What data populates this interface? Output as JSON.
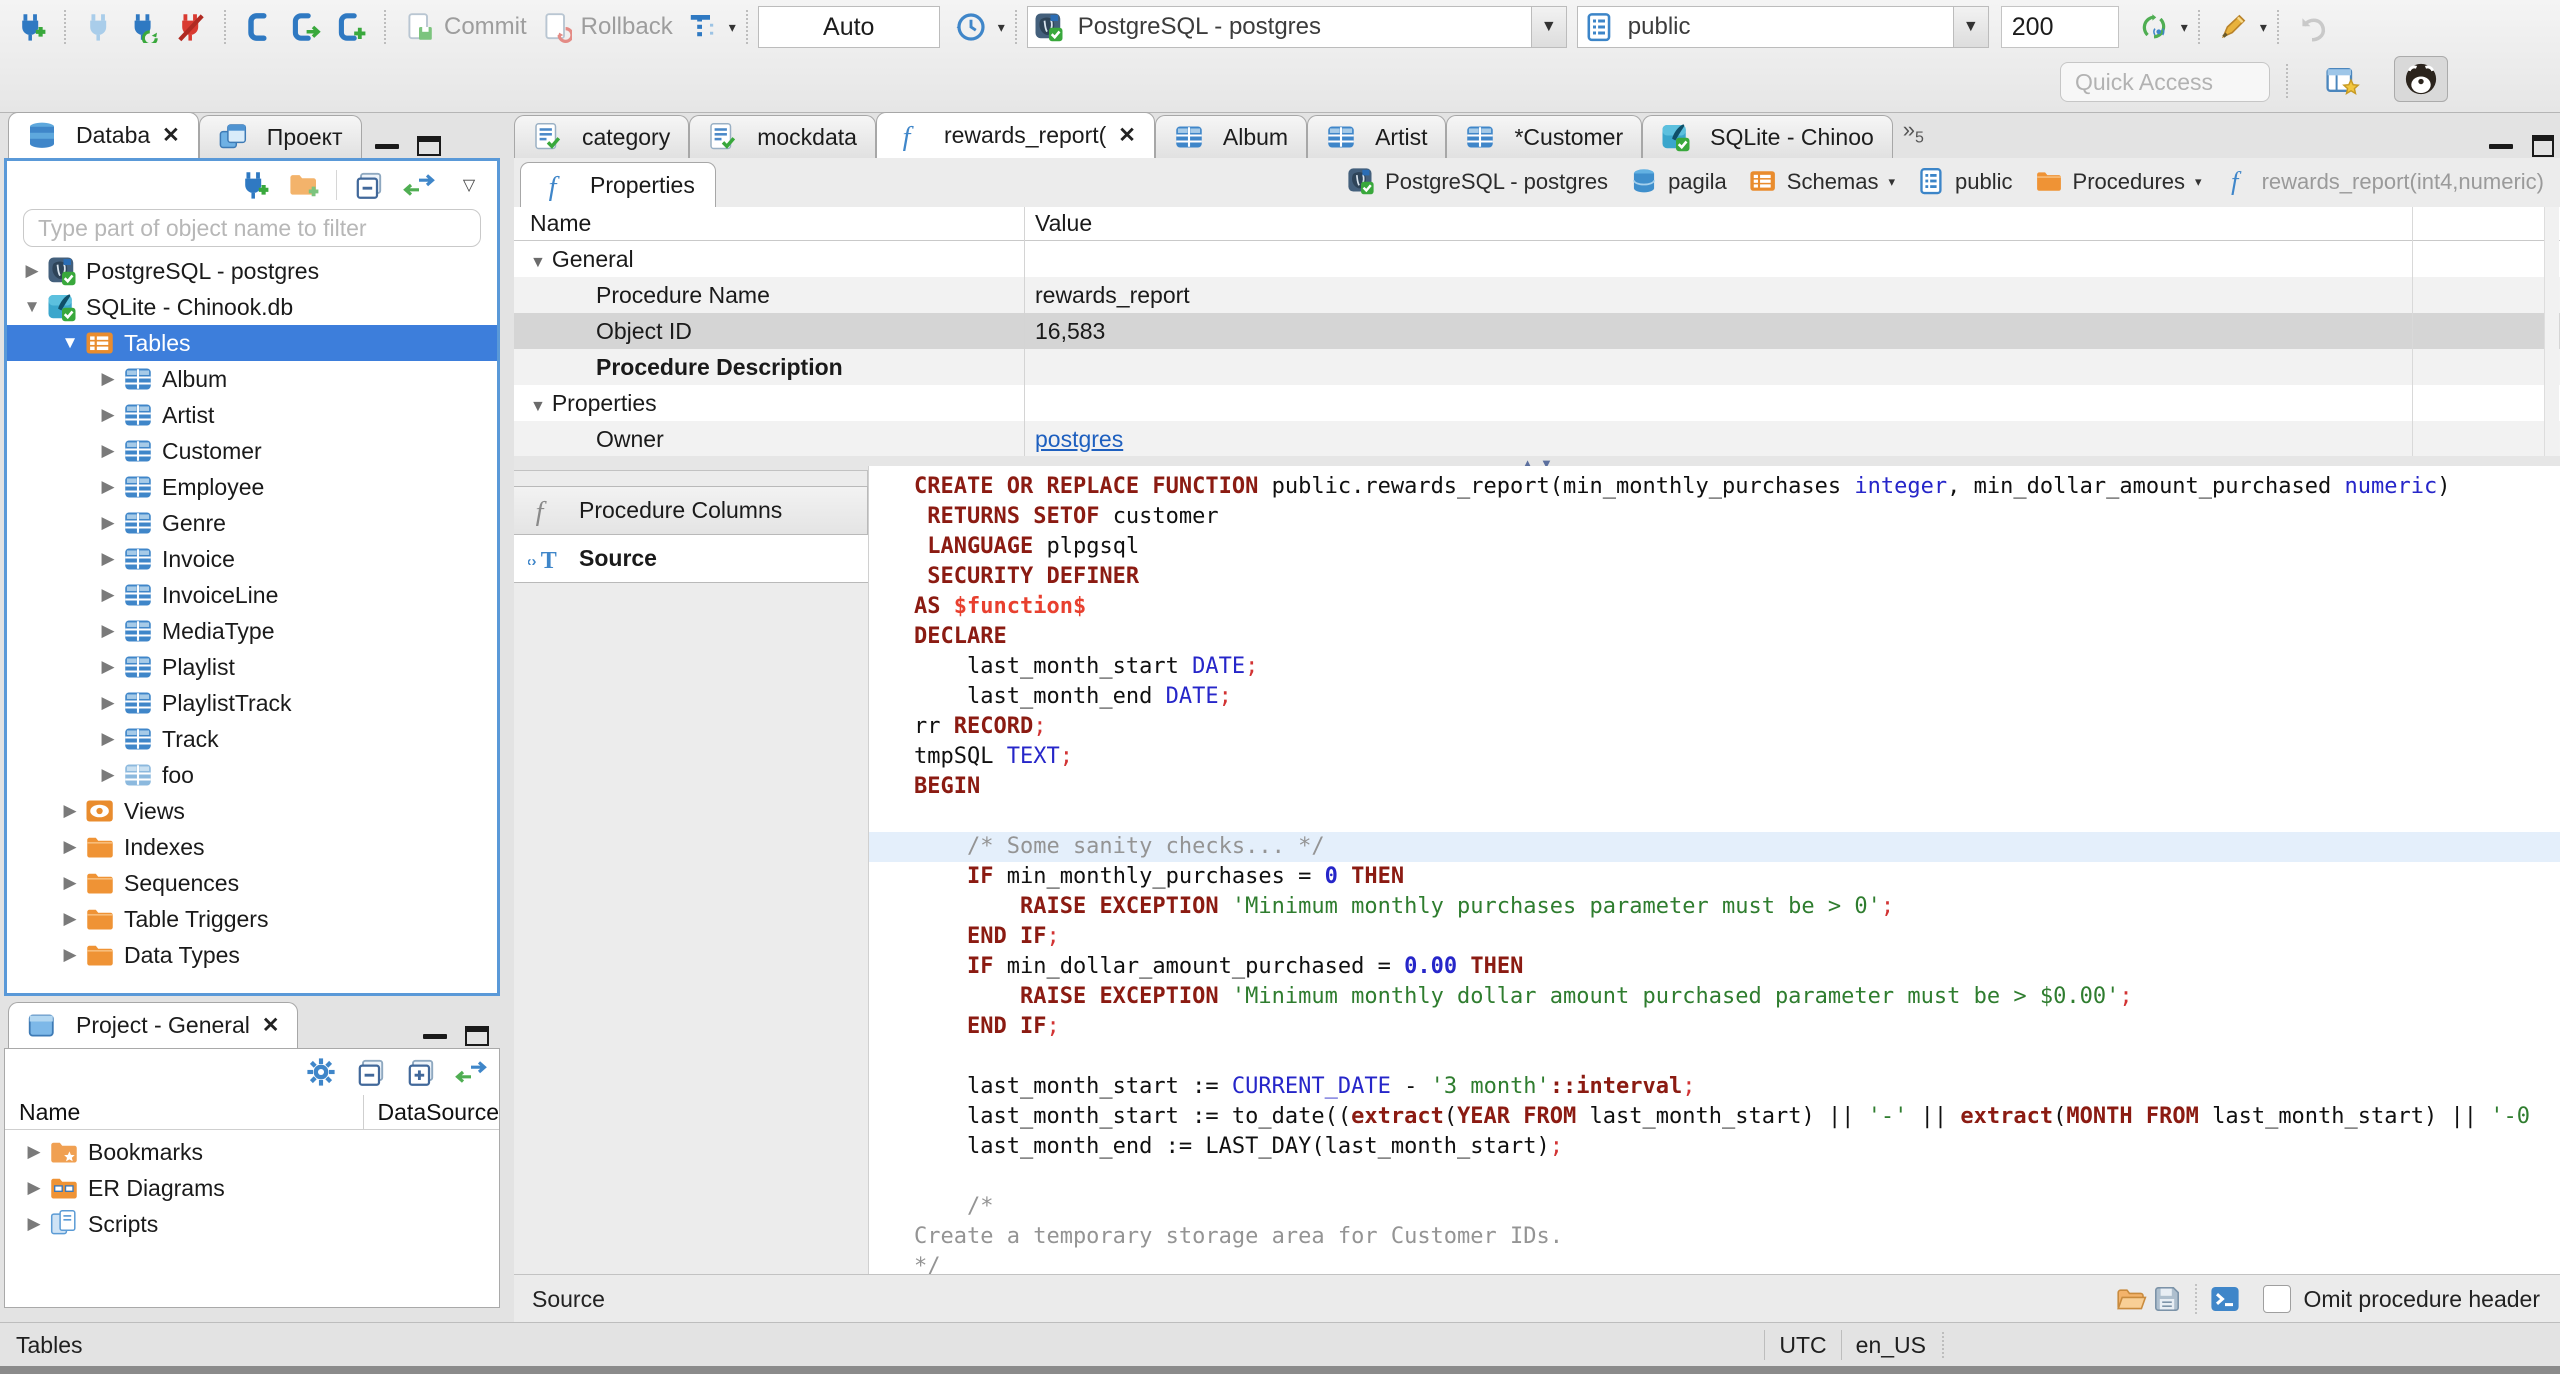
{
  "toolbar": {
    "commit": "Commit",
    "rollback": "Rollback",
    "txn_mode": "Auto",
    "connection": "PostgreSQL - postgres",
    "schema": "public",
    "fetch_size": "200",
    "quick_access": "Quick Access"
  },
  "navigator": {
    "tabs": [
      {
        "label": "Databa",
        "icon": "db-navigator",
        "active": true,
        "closable": true
      },
      {
        "label": "Проект",
        "icon": "windows"
      }
    ],
    "filter_placeholder": "Type part of object name to filter",
    "tree": [
      {
        "label": "PostgreSQL - postgres",
        "icon": "postgres",
        "depth": 0,
        "twist": "right"
      },
      {
        "label": "SQLite - Chinook.db",
        "icon": "sqlite",
        "depth": 0,
        "twist": "down"
      },
      {
        "label": "Tables",
        "icon": "tables-folder",
        "depth": 1,
        "twist": "down",
        "selected": true
      },
      {
        "label": "Album",
        "icon": "table",
        "depth": 2,
        "twist": "right"
      },
      {
        "label": "Artist",
        "icon": "table",
        "depth": 2,
        "twist": "right"
      },
      {
        "label": "Customer",
        "icon": "table",
        "depth": 2,
        "twist": "right"
      },
      {
        "label": "Employee",
        "icon": "table",
        "depth": 2,
        "twist": "right"
      },
      {
        "label": "Genre",
        "icon": "table",
        "depth": 2,
        "twist": "right"
      },
      {
        "label": "Invoice",
        "icon": "table",
        "depth": 2,
        "twist": "right"
      },
      {
        "label": "InvoiceLine",
        "icon": "table",
        "depth": 2,
        "twist": "right"
      },
      {
        "label": "MediaType",
        "icon": "table",
        "depth": 2,
        "twist": "right"
      },
      {
        "label": "Playlist",
        "icon": "table",
        "depth": 2,
        "twist": "right"
      },
      {
        "label": "PlaylistTrack",
        "icon": "table",
        "depth": 2,
        "twist": "right"
      },
      {
        "label": "Track",
        "icon": "table",
        "depth": 2,
        "twist": "right"
      },
      {
        "label": "foo",
        "icon": "table-light",
        "depth": 2,
        "twist": "right"
      },
      {
        "label": "Views",
        "icon": "views",
        "depth": 1,
        "twist": "right"
      },
      {
        "label": "Indexes",
        "icon": "folder",
        "depth": 1,
        "twist": "right"
      },
      {
        "label": "Sequences",
        "icon": "folder",
        "depth": 1,
        "twist": "right"
      },
      {
        "label": "Table Triggers",
        "icon": "folder",
        "depth": 1,
        "twist": "right"
      },
      {
        "label": "Data Types",
        "icon": "folder",
        "depth": 1,
        "twist": "right"
      }
    ]
  },
  "project": {
    "title": "Project - General",
    "columns": [
      "Name",
      "DataSource"
    ],
    "items": [
      {
        "label": "Bookmarks",
        "icon": "bookmarks"
      },
      {
        "label": "ER Diagrams",
        "icon": "erd"
      },
      {
        "label": "Scripts",
        "icon": "scripts"
      }
    ]
  },
  "editor": {
    "tabs": [
      {
        "label": "category",
        "icon": "sql-script"
      },
      {
        "label": "mockdata",
        "icon": "sql-script"
      },
      {
        "label": "rewards_report(",
        "icon": "function",
        "active": true,
        "closable": true
      },
      {
        "label": "Album",
        "icon": "table"
      },
      {
        "label": "Artist",
        "icon": "table"
      },
      {
        "label": "*Customer",
        "icon": "table"
      },
      {
        "label": "SQLite - Chinoo",
        "icon": "sqlite"
      }
    ],
    "overflow_count": "5",
    "properties_tab": "Properties",
    "breadcrumb": [
      {
        "label": "PostgreSQL - postgres",
        "icon": "postgres"
      },
      {
        "label": "pagila",
        "icon": "database"
      },
      {
        "label": "Schemas",
        "icon": "tables-folder",
        "dropdown": true
      },
      {
        "label": "public",
        "icon": "schema"
      },
      {
        "label": "Procedures",
        "icon": "folder",
        "dropdown": true
      },
      {
        "label": "rewards_report(int4,numeric)",
        "icon": "function",
        "dim": true
      }
    ],
    "grid_columns": [
      "Name",
      "Value"
    ],
    "grid_rows": [
      {
        "name": "General",
        "group": true
      },
      {
        "name": "Procedure Name",
        "value": "rewards_report",
        "zebra": true
      },
      {
        "name": "Object ID",
        "value": "16,583",
        "selected": true
      },
      {
        "name": "Procedure Description",
        "value": "",
        "bold": true,
        "zebra": true
      },
      {
        "name": "Properties",
        "group": true
      },
      {
        "name": "Owner",
        "value": "postgres",
        "link": true,
        "zebra": true
      }
    ],
    "side_tabs": [
      {
        "label": "Procedure Columns",
        "icon": "function-gray"
      },
      {
        "label": "Source",
        "icon": "source",
        "active": true
      }
    ],
    "status_left": "Source",
    "omit_checkbox_label": "Omit procedure header"
  },
  "source_code": {
    "lines": [
      {
        "t": [
          [
            "k",
            "CREATE OR REPLACE FUNCTION "
          ],
          [
            "d",
            "public.rewards_report(min_monthly_purchases "
          ],
          [
            "t",
            "integer"
          ],
          [
            "d",
            ", min_dollar_amount_purchased "
          ],
          [
            "t",
            "numeric"
          ],
          [
            "d",
            ")"
          ]
        ]
      },
      {
        "t": [
          [
            "d",
            " "
          ],
          [
            "k",
            "RETURNS SETOF "
          ],
          [
            "d",
            "customer"
          ]
        ]
      },
      {
        "t": [
          [
            "d",
            " "
          ],
          [
            "k",
            "LANGUAGE "
          ],
          [
            "d",
            "plpgsql"
          ]
        ]
      },
      {
        "t": [
          [
            "d",
            " "
          ],
          [
            "k",
            "SECURITY DEFINER"
          ]
        ]
      },
      {
        "t": [
          [
            "k",
            "AS "
          ],
          [
            "f",
            "$function$"
          ]
        ]
      },
      {
        "t": [
          [
            "k",
            "DECLARE"
          ]
        ]
      },
      {
        "t": [
          [
            "d",
            "    last_month_start "
          ],
          [
            "t",
            "DATE"
          ],
          [
            "p",
            ";"
          ]
        ]
      },
      {
        "t": [
          [
            "d",
            "    last_month_end "
          ],
          [
            "t",
            "DATE"
          ],
          [
            "p",
            ";"
          ]
        ]
      },
      {
        "t": [
          [
            "d",
            "rr "
          ],
          [
            "k",
            "RECORD"
          ],
          [
            "p",
            ";"
          ]
        ]
      },
      {
        "t": [
          [
            "d",
            "tmpSQL "
          ],
          [
            "t",
            "TEXT"
          ],
          [
            "p",
            ";"
          ]
        ]
      },
      {
        "t": [
          [
            "k",
            "BEGIN"
          ]
        ]
      },
      {
        "t": []
      },
      {
        "hl": true,
        "t": [
          [
            "c",
            "    /* Some sanity checks... */"
          ]
        ]
      },
      {
        "t": [
          [
            "d",
            "    "
          ],
          [
            "k",
            "IF"
          ],
          [
            "d",
            " min_monthly_purchases = "
          ],
          [
            "n",
            "0"
          ],
          [
            "d",
            " "
          ],
          [
            "k",
            "THEN"
          ]
        ]
      },
      {
        "t": [
          [
            "d",
            "        "
          ],
          [
            "k",
            "RAISE EXCEPTION "
          ],
          [
            "s",
            "'Minimum monthly purchases parameter must be > 0'"
          ],
          [
            "p",
            ";"
          ]
        ]
      },
      {
        "t": [
          [
            "d",
            "    "
          ],
          [
            "k",
            "END IF"
          ],
          [
            "p",
            ";"
          ]
        ]
      },
      {
        "t": [
          [
            "d",
            "    "
          ],
          [
            "k",
            "IF"
          ],
          [
            "d",
            " min_dollar_amount_purchased = "
          ],
          [
            "n",
            "0.00"
          ],
          [
            "d",
            " "
          ],
          [
            "k",
            "THEN"
          ]
        ]
      },
      {
        "t": [
          [
            "d",
            "        "
          ],
          [
            "k",
            "RAISE EXCEPTION "
          ],
          [
            "s",
            "'Minimum monthly dollar amount purchased parameter must be > $0.00'"
          ],
          [
            "p",
            ";"
          ]
        ]
      },
      {
        "t": [
          [
            "d",
            "    "
          ],
          [
            "k",
            "END IF"
          ],
          [
            "p",
            ";"
          ]
        ]
      },
      {
        "t": []
      },
      {
        "t": [
          [
            "d",
            "    last_month_start := "
          ],
          [
            "t",
            "CURRENT_DATE"
          ],
          [
            "d",
            " - "
          ],
          [
            "s",
            "'3 month'"
          ],
          [
            "k",
            "::interval"
          ],
          [
            "p",
            ";"
          ]
        ]
      },
      {
        "t": [
          [
            "d",
            "    last_month_start := to_date(("
          ],
          [
            "k",
            "extract"
          ],
          [
            "d",
            "("
          ],
          [
            "k",
            "YEAR FROM"
          ],
          [
            "d",
            " last_month_start) || "
          ],
          [
            "s",
            "'-'"
          ],
          [
            "d",
            " || "
          ],
          [
            "k",
            "extract"
          ],
          [
            "d",
            "("
          ],
          [
            "k",
            "MONTH FROM"
          ],
          [
            "d",
            " last_month_start) || "
          ],
          [
            "s",
            "'-0"
          ]
        ]
      },
      {
        "t": [
          [
            "d",
            "    last_month_end := LAST_DAY(last_month_start)"
          ],
          [
            "p",
            ";"
          ]
        ]
      },
      {
        "t": []
      },
      {
        "t": [
          [
            "c",
            "    /*"
          ]
        ]
      },
      {
        "t": [
          [
            "c",
            "Create a temporary storage area for Customer IDs."
          ]
        ]
      },
      {
        "t": [
          [
            "c",
            "*/"
          ]
        ]
      }
    ]
  },
  "statusbar": {
    "left": "Tables",
    "timezone": "UTC",
    "locale": "en_US"
  }
}
